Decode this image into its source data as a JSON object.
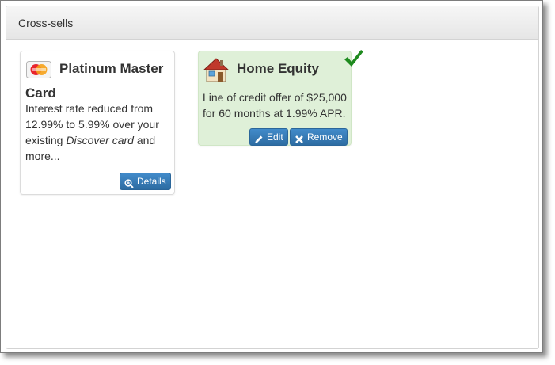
{
  "panel": {
    "title": "Cross-sells"
  },
  "cards": [
    {
      "title": "Platinum Master Card",
      "icon": "credit-card-icon",
      "text_before": "Interest rate reduced from 12.99% to 5.99% over your existing ",
      "text_em": "Discover card",
      "text_after": " and more...",
      "buttons": {
        "details": "Details"
      },
      "details_icon": "zoom-in-icon"
    },
    {
      "title": "Home Equity",
      "icon": "house-icon",
      "text": "Line of credit offer of $25,000 for 60 months at 1.99% APR.",
      "selected": true,
      "buttons": {
        "edit": "Edit",
        "remove": "Remove"
      },
      "edit_icon": "pencil-icon",
      "remove_icon": "x-icon"
    }
  ],
  "colors": {
    "selected_card_bg": "#dff0d8",
    "button_blue": "#428bca",
    "check_green": "#1e8a1e"
  }
}
